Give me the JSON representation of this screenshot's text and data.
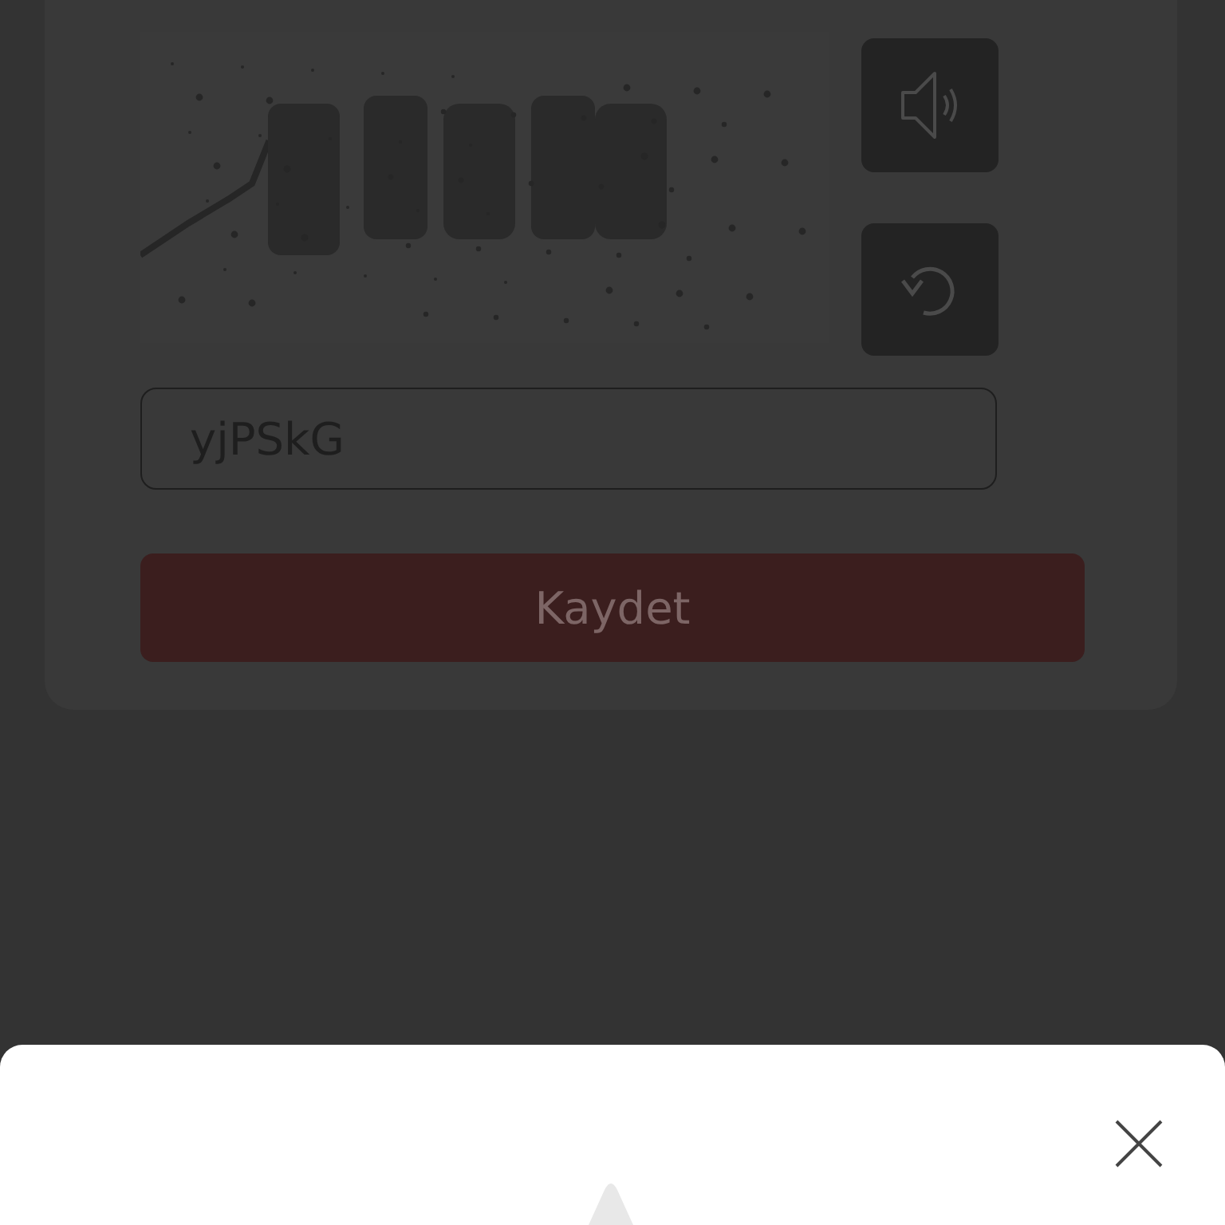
{
  "answer_field": {
    "value": "yjPSkG"
  },
  "submit_button": {
    "label": "Kaydet"
  }
}
